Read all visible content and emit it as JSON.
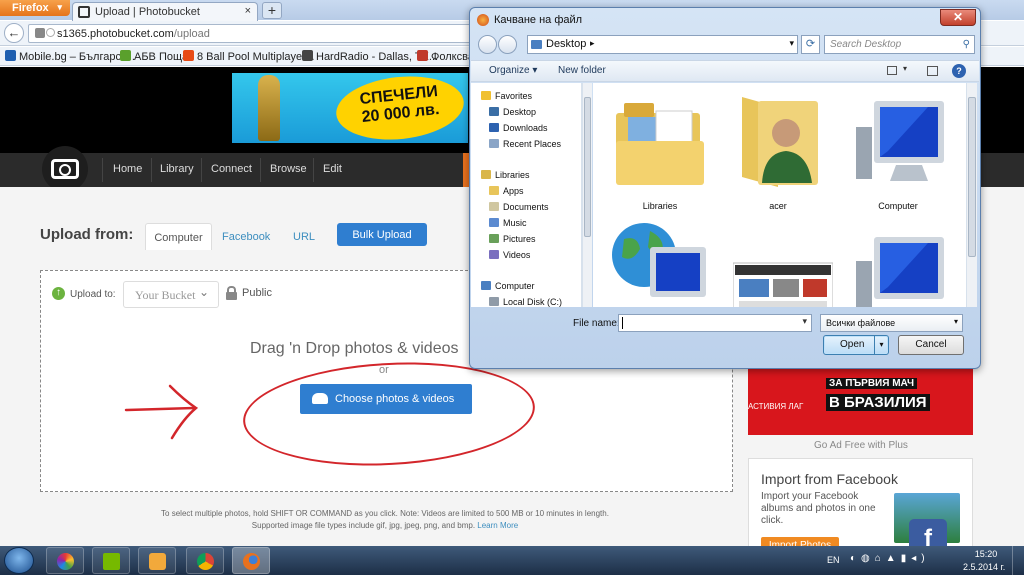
{
  "browser": {
    "menu_button": "Firefox",
    "tab_title": "Upload | Photobucket",
    "new_tab": "+",
    "url_host": "s1365.photobucket.com",
    "url_path": "/upload",
    "bookmarks": [
      {
        "label": "Mobile.bg – Българск...",
        "color": "#1f5fb0"
      },
      {
        "label": "АБВ Поща",
        "color": "#5aa02c"
      },
      {
        "label": "8 Ball Pool Multiplayer...",
        "color": "#e84b16"
      },
      {
        "label": "HardRadio - Dallas, TX...",
        "color": "#444444"
      },
      {
        "label": "Фолксва",
        "color": "#c0392b"
      }
    ]
  },
  "ad_banner": {
    "line1": "СПЕЧЕЛИ",
    "line2": "20 000 лв."
  },
  "site_nav": {
    "items": [
      "Home",
      "Library",
      "Connect",
      "Browse",
      "Edit"
    ]
  },
  "upload": {
    "heading": "Upload from:",
    "tabs": [
      "Computer",
      "Facebook",
      "URL"
    ],
    "bulk_upload": "Bulk Upload",
    "upload_to": "Upload to:",
    "bucket": "Your Bucket",
    "privacy": "Public",
    "drag_text": "Drag 'n Drop photos & videos",
    "or": "or",
    "choose_button": "Choose photos & videos",
    "hint_line1": "To select multiple photos, hold SHIFT OR COMMAND as you click. Note: Videos are limited to 500 MB or 10 minutes in length.",
    "hint_line2": "Supported image file types include gif, jpg, jpeg, png, and bmp.",
    "hint_link": "Learn More"
  },
  "sidebar": {
    "red_ad_line1": "ЗА ПЪРВИЯ МАЧ",
    "red_ad_line2": "В БРАЗИЛИЯ",
    "red_ad_side": "АСТИВИЯ\nЛАГ",
    "ad_free": "Go Ad Free with Plus",
    "import_title": "Import from Facebook",
    "import_desc": "Import your Facebook albums and photos in one click.",
    "import_button": "Import Photos"
  },
  "dialog": {
    "title": "Качване на файл",
    "close": "✕",
    "address": "Desktop",
    "search_placeholder": "Search Desktop",
    "organize": "Organize",
    "new_folder": "New folder",
    "nav": [
      {
        "label": "Favorites",
        "color": "#f0c030"
      },
      {
        "label": "Desktop",
        "color": "#3a6ea5"
      },
      {
        "label": "Downloads",
        "color": "#2d62b0"
      },
      {
        "label": "Recent Places",
        "color": "#8aa5c7"
      },
      {
        "label": "Libraries",
        "color": "#d9b64a"
      },
      {
        "label": "Apps",
        "color": "#e8c55a"
      },
      {
        "label": "Documents",
        "color": "#d0c7a0"
      },
      {
        "label": "Music",
        "color": "#5b8ad0"
      },
      {
        "label": "Pictures",
        "color": "#69a05a"
      },
      {
        "label": "Videos",
        "color": "#7a6fbf"
      },
      {
        "label": "Computer",
        "color": "#4a7fc1"
      },
      {
        "label": "Local Disk (C:)",
        "color": "#8f9ba8"
      }
    ],
    "files": [
      {
        "label": "Libraries",
        "icon": "libraries-folder-icon"
      },
      {
        "label": "acer",
        "icon": "user-folder-icon"
      },
      {
        "label": "Computer",
        "icon": "computer-icon"
      },
      {
        "label": "",
        "icon": "network-globe-icon"
      },
      {
        "label": "",
        "icon": "screenshot-thumbnail"
      },
      {
        "label": "",
        "icon": "computer-icon"
      }
    ],
    "file_name_label": "File name:",
    "file_name_value": "",
    "file_type": "Всички файлове",
    "open": "Open",
    "cancel": "Cancel"
  },
  "taskbar": {
    "language": "EN",
    "time": "15:20",
    "date": "2.5.2014 г."
  }
}
